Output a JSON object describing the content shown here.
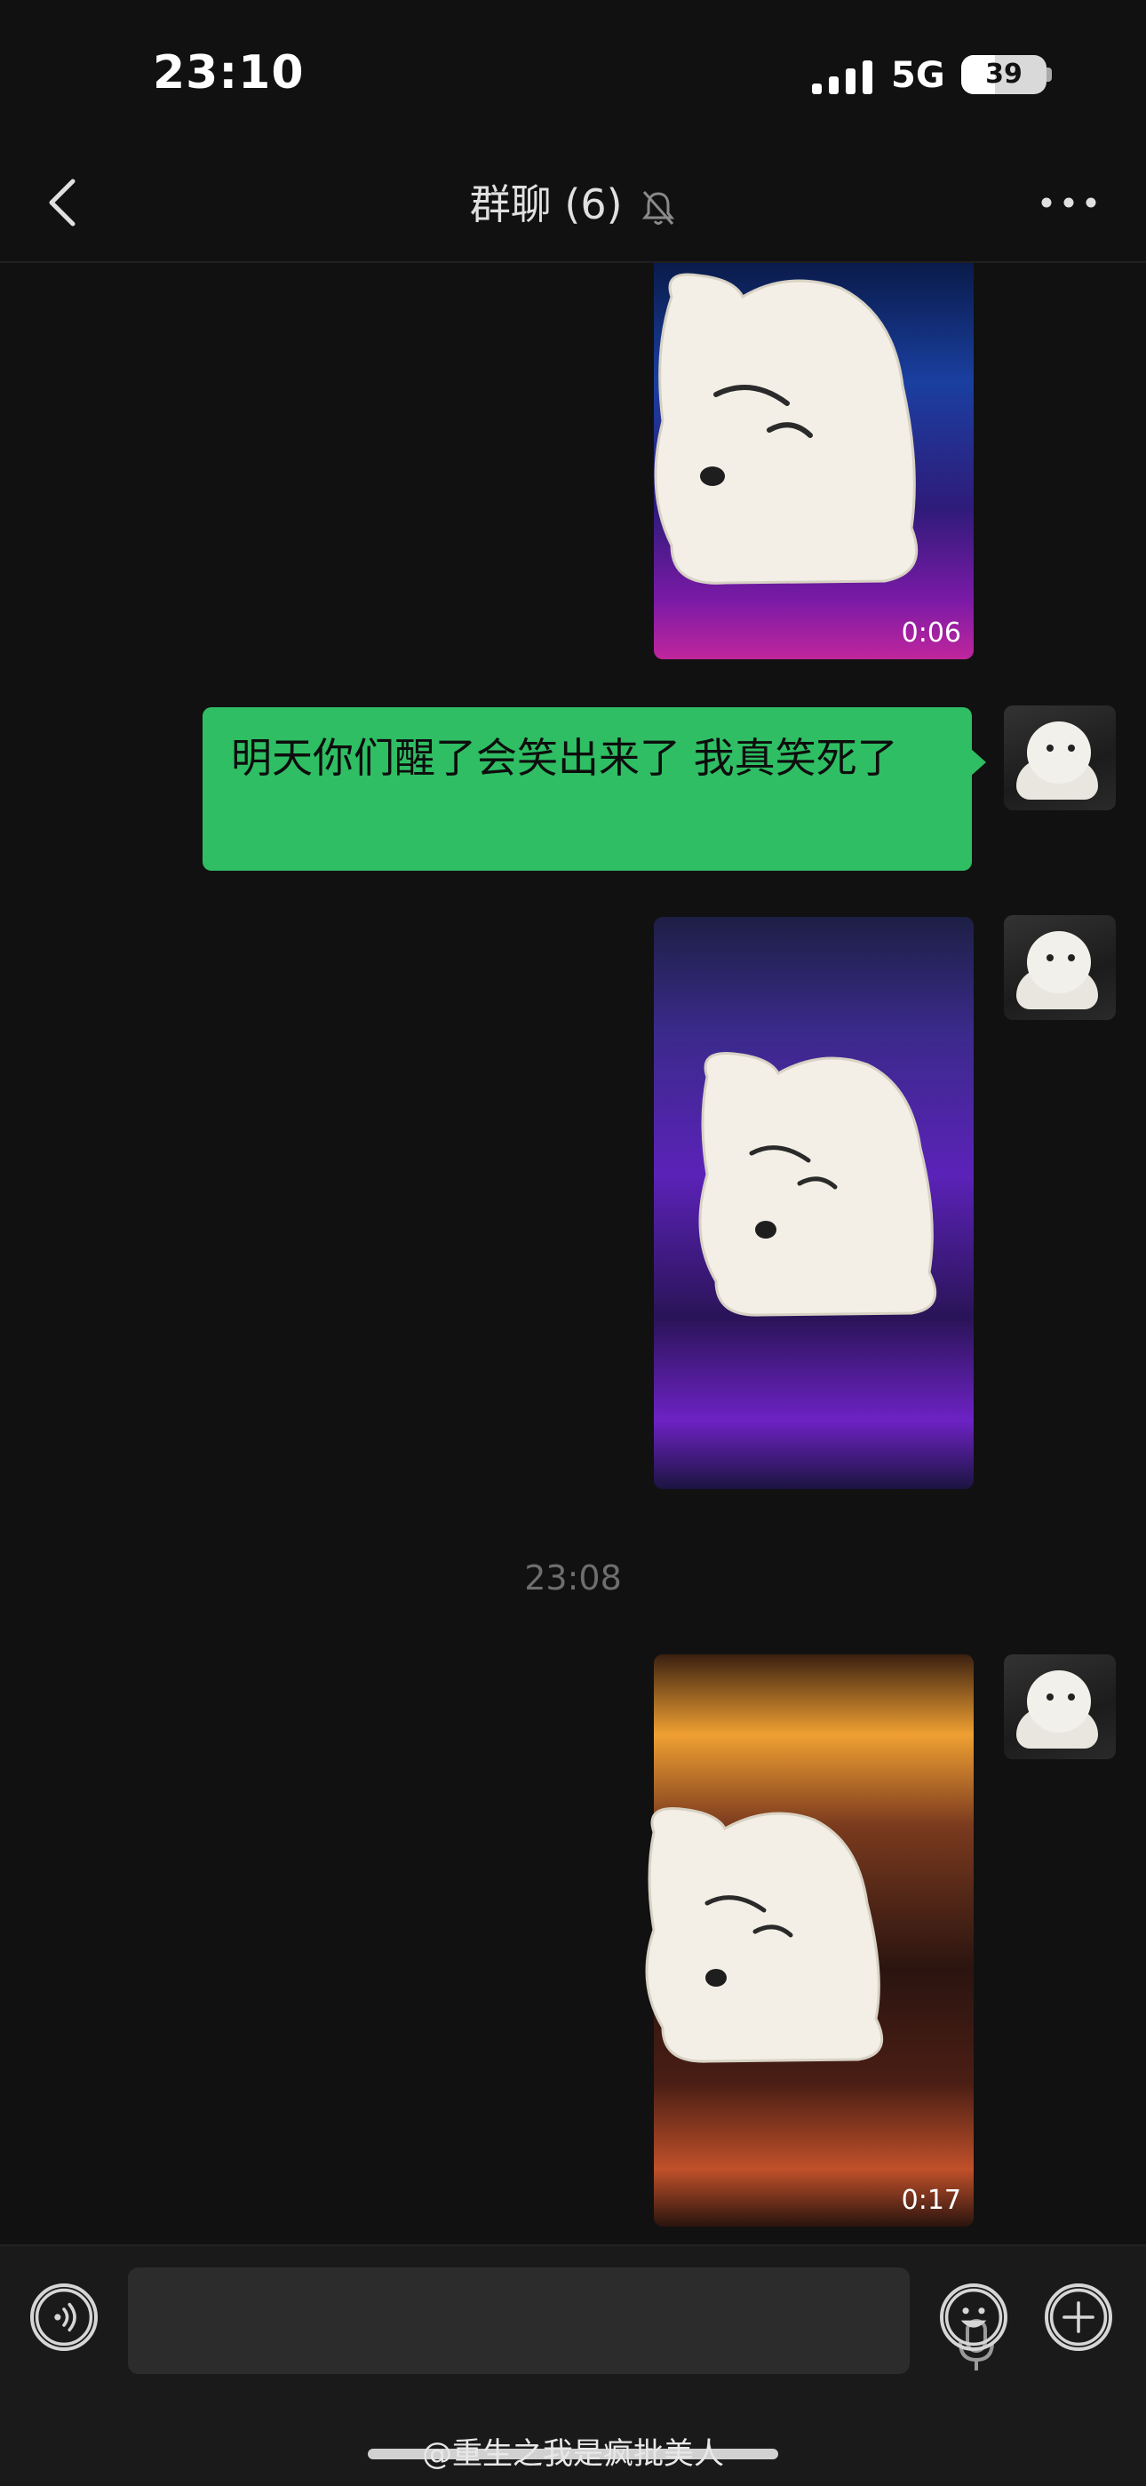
{
  "status_bar": {
    "time": "23:10",
    "network": "5G",
    "battery": "39"
  },
  "nav": {
    "title": "群聊 (6)",
    "back_icon": "chevron-left-icon",
    "mute_icon": "bell-slash-icon",
    "more_icon": "more-dots-icon"
  },
  "messages": [
    {
      "type": "video",
      "sender": "self",
      "duration": "0:06"
    },
    {
      "type": "text",
      "sender": "self",
      "text": "明天你们醒了会笑出来了 我真笑死了"
    },
    {
      "type": "video",
      "sender": "self",
      "duration": ""
    },
    {
      "type": "time",
      "text": "23:08"
    },
    {
      "type": "video",
      "sender": "self",
      "duration": "0:17"
    }
  ],
  "input_bar": {
    "voice_icon": "voice-icon",
    "mic_icon": "mic-icon",
    "emoji_icon": "emoji-icon",
    "plus_icon": "plus-icon"
  },
  "watermark": "@重生之我是疯批美人",
  "colors": {
    "bubble": "#2fbe63",
    "background": "#111111"
  }
}
